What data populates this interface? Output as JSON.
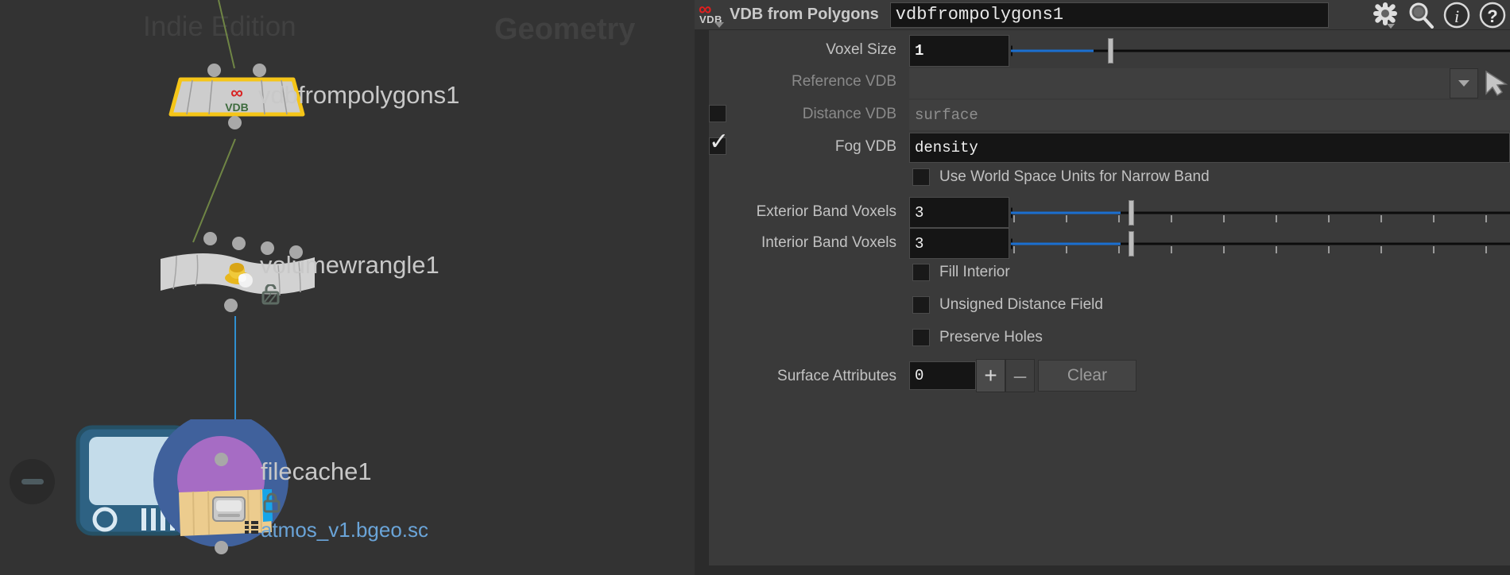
{
  "network": {
    "watermark_edition": "Indie Edition",
    "watermark_context": "Geometry",
    "collapse_icon": "minus-circle-icon",
    "nodes": [
      {
        "name": "vdbfrompolygons1",
        "icon": "vdb-node-icon",
        "sublabel": "",
        "flag": "",
        "selected": true
      },
      {
        "name": "volumewrangle1",
        "icon": "wrangle-node-icon",
        "sublabel": "",
        "flag": "unlock-icon",
        "selected": false
      },
      {
        "name": "filecache1",
        "icon": "filecache-node-icon",
        "sublabel": "atmos_v1.bgeo.sc",
        "flag": "lock-icon",
        "selected": false
      }
    ]
  },
  "panel": {
    "header": {
      "node_type_icon": "vdb-openvdb-icon",
      "node_type_label": "VDB from Polygons",
      "node_name": "vdbfrompolygons1",
      "icons": [
        "gear-icon",
        "search-icon",
        "info-icon",
        "help-icon"
      ]
    },
    "accent_blue": "#1b6fd0",
    "rows": [
      {
        "id": "voxelsize",
        "kind": "float-slider",
        "label": "Voxel Size",
        "value": "1",
        "slider": {
          "fill_pct": 16.5,
          "handle_pct": 19.5,
          "ticks": 0
        },
        "disabled": false
      },
      {
        "id": "referencevdb",
        "kind": "menu-string",
        "label": "Reference VDB",
        "value": "",
        "placeholder": "",
        "menu_icon": "chevron-down-icon",
        "picker_icon": "node-picker-arrow-icon",
        "disabled": true
      },
      {
        "id": "distancevdb",
        "kind": "toggle-string",
        "label": "Distance VDB",
        "value": "",
        "placeholder": "surface",
        "checked": false,
        "disabled": true
      },
      {
        "id": "fogvdb",
        "kind": "toggle-string",
        "label": "Fog VDB",
        "value": "density",
        "placeholder": "",
        "checked": true,
        "disabled": false
      },
      {
        "id": "worldspaceunits",
        "kind": "checkbox",
        "label": "Use World Space Units for Narrow Band",
        "checked": false
      },
      {
        "id": "exteriorband",
        "kind": "int-slider",
        "label": "Exterior Band Voxels",
        "value": "3",
        "slider": {
          "fill_pct": 22,
          "handle_pct": 23.5,
          "ticks": 9
        },
        "disabled": false
      },
      {
        "id": "interiorband",
        "kind": "int-slider",
        "label": "Interior Band Voxels",
        "value": "3",
        "slider": {
          "fill_pct": 22,
          "handle_pct": 23.5,
          "ticks": 9
        },
        "disabled": false
      },
      {
        "id": "fillinterior",
        "kind": "checkbox",
        "label": "Fill Interior",
        "checked": false
      },
      {
        "id": "unsigneddistancefield",
        "kind": "checkbox",
        "label": "Unsigned Distance Field",
        "checked": false
      },
      {
        "id": "preserveholes",
        "kind": "checkbox",
        "label": "Preserve Holes",
        "checked": false
      },
      {
        "id": "surfaceattributes",
        "kind": "multiparm",
        "label": "Surface Attributes",
        "value": "0",
        "add_label": "+",
        "remove_label": "–",
        "clear_label": "Clear"
      }
    ]
  }
}
